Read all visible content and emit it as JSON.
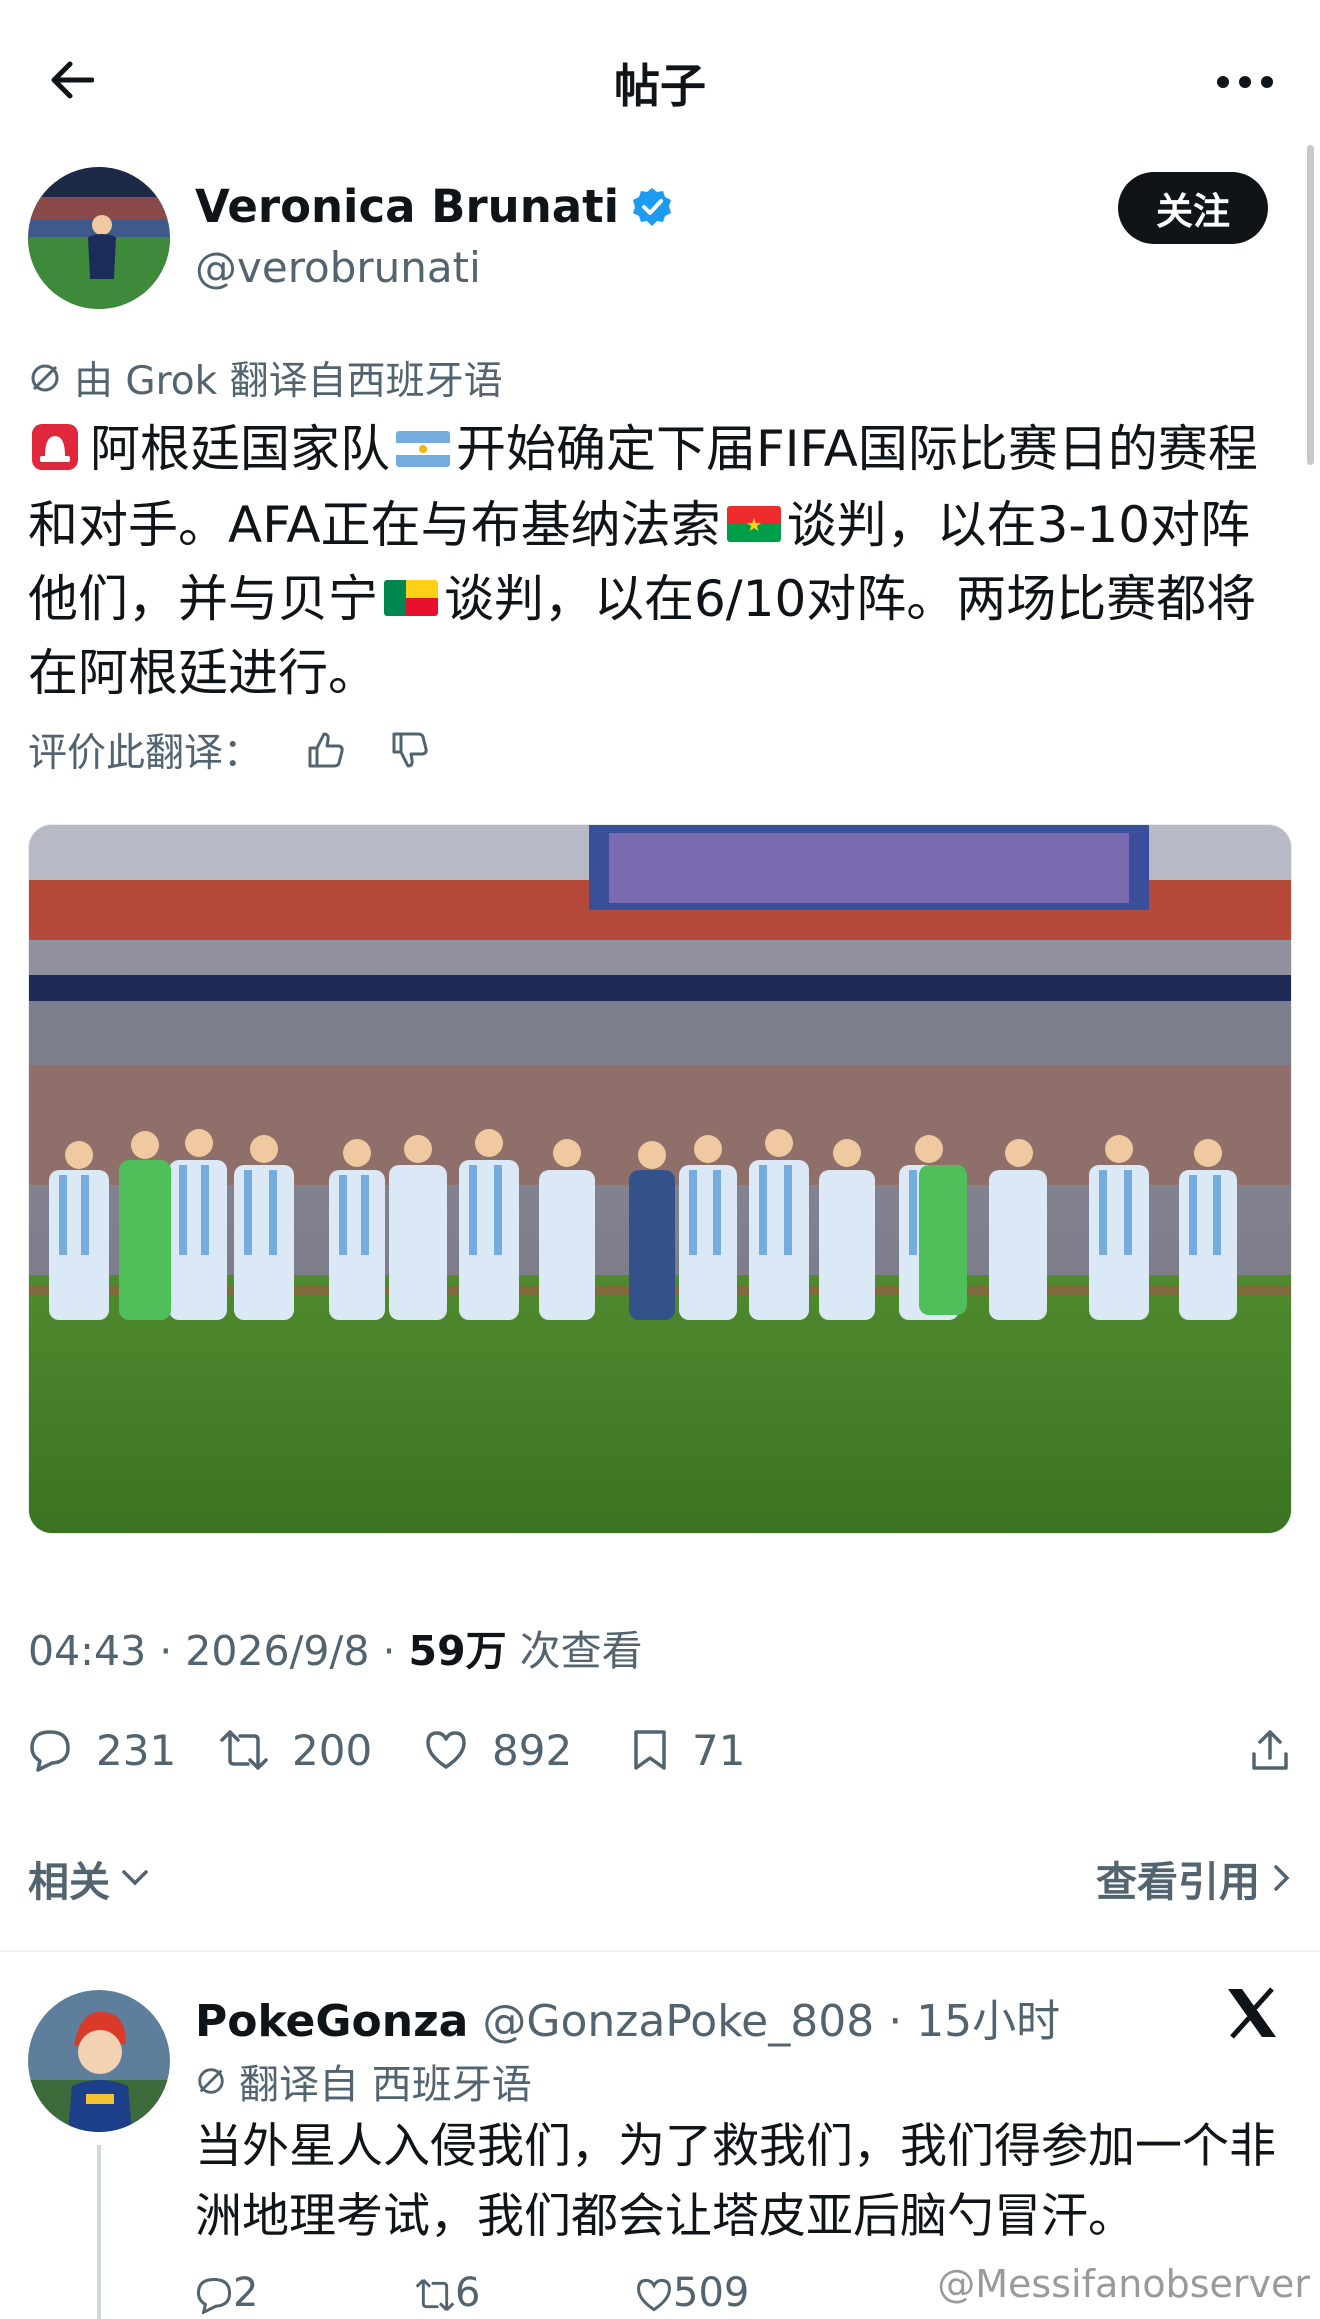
{
  "header": {
    "title": "帖子",
    "back_icon": "arrow-left-icon",
    "more_icon": "more-horizontal-icon"
  },
  "author": {
    "display_name": "Veronica Brunati",
    "handle": "@verobrunati",
    "verified": true,
    "verified_color": "#1d9bf0",
    "follow_label": "关注"
  },
  "post": {
    "translated_note": "由 Grok 翻译自西班牙语",
    "text": {
      "p1": "阿根廷国家队",
      "p2": "开始确定下届FIFA国际比赛日的赛程和对手。AFA正在与布基纳法索",
      "p3": "谈判，以在3-10对阵他们，并与贝宁",
      "p4": "谈判，以在6/10对阵。两场比赛都将在阿根廷进行。"
    },
    "rate_label": "评价此翻译：",
    "time": "04:43",
    "date": "2026/9/8",
    "views_count": "59万",
    "views_label": "次查看",
    "stats": {
      "replies": "231",
      "reposts": "200",
      "likes": "892",
      "bookmarks": "71"
    }
  },
  "related": {
    "label": "相关",
    "quotes_label": "查看引用"
  },
  "reply": {
    "name": "PokeGonza",
    "handle": "@GonzaPoke_808",
    "time": "15小时",
    "translated_note": "翻译自 西班牙语",
    "text": "当外星人入侵我们，为了救我们，我们得参加一个非洲地理考试，我们都会让塔皮亚后脑勺冒汗。",
    "stats": {
      "replies": "2",
      "reposts": "6",
      "likes": "509"
    }
  },
  "watermark": "@Messifanobserver",
  "colors": {
    "text_primary": "#0f1419",
    "text_secondary": "#536471",
    "accent": "#1d9bf0",
    "argentina_blue": "#74acdf"
  }
}
